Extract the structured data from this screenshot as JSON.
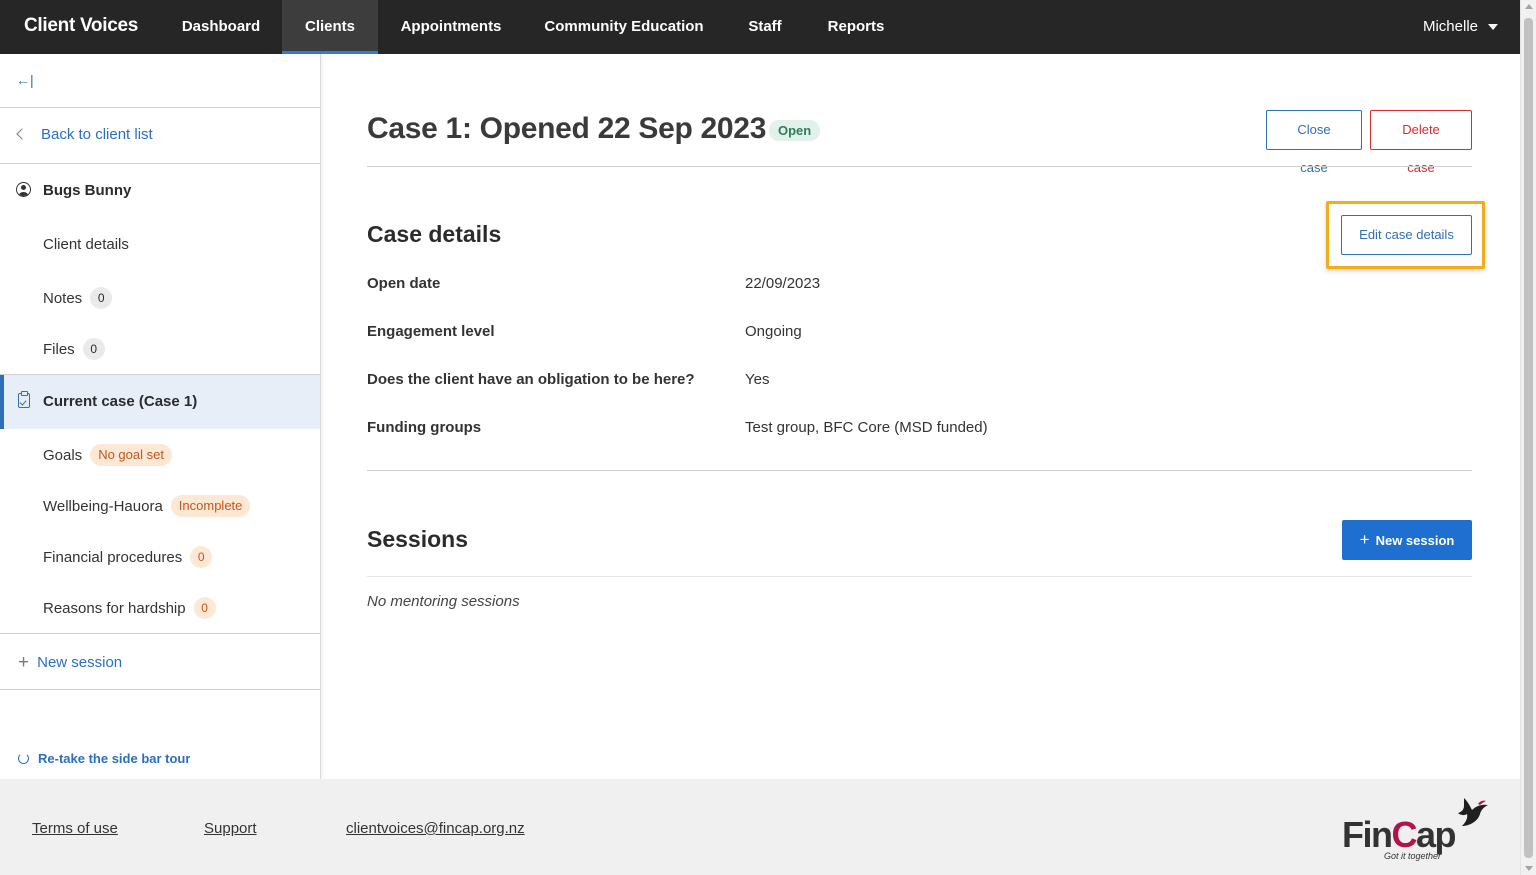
{
  "app": {
    "brand": "Client Voices",
    "user_name": "Michelle"
  },
  "nav": {
    "items": [
      {
        "label": "Dashboard"
      },
      {
        "label": "Clients"
      },
      {
        "label": "Appointments"
      },
      {
        "label": "Community Education"
      },
      {
        "label": "Staff"
      },
      {
        "label": "Reports"
      }
    ],
    "active": "Clients"
  },
  "sidebar": {
    "collapse_icon": "collapse-left-icon",
    "back_label": "Back to client list",
    "client_name": "Bugs Bunny",
    "client_items": [
      {
        "label": "Client details"
      },
      {
        "label": "Notes",
        "count": "0"
      },
      {
        "label": "Files",
        "count": "0"
      }
    ],
    "current_case_label": "Current case (Case 1)",
    "case_items": [
      {
        "label": "Goals",
        "status": "No goal set"
      },
      {
        "label": "Wellbeing-Hauora",
        "status": "Incomplete"
      },
      {
        "label": "Financial procedures",
        "count": "0"
      },
      {
        "label": "Reasons for hardship",
        "count": "0"
      }
    ],
    "new_session_label": "New session",
    "retake_tour_label": "Re-take the side bar tour"
  },
  "case": {
    "title": "Case 1: Opened 22 Sep 2023",
    "status": "Open",
    "close_label": "Close case",
    "delete_label": "Delete case"
  },
  "case_details": {
    "heading": "Case details",
    "edit_label": "Edit case details",
    "fields": [
      {
        "label": "Open date",
        "value": "22/09/2023"
      },
      {
        "label": "Engagement level",
        "value": "Ongoing"
      },
      {
        "label": "Does the client have an obligation to be here?",
        "value": "Yes"
      },
      {
        "label": "Funding groups",
        "value": "Test group, BFC Core (MSD funded)"
      }
    ]
  },
  "sessions": {
    "heading": "Sessions",
    "new_label": "New session",
    "empty_text": "No mentoring sessions"
  },
  "footer": {
    "terms_label": "Terms of use",
    "support_label": "Support",
    "email": "clientvoices@fincap.org.nz",
    "logo": {
      "name": "FinCap",
      "tagline": "Got it together"
    }
  },
  "colors": {
    "nav_bg": "#262626",
    "accent_blue": "#1f6fd1",
    "danger_red": "#d32f2f",
    "highlight_orange": "#f3ac1b",
    "open_green": "#2e7d5b",
    "warning_orange": "#c4571a"
  }
}
